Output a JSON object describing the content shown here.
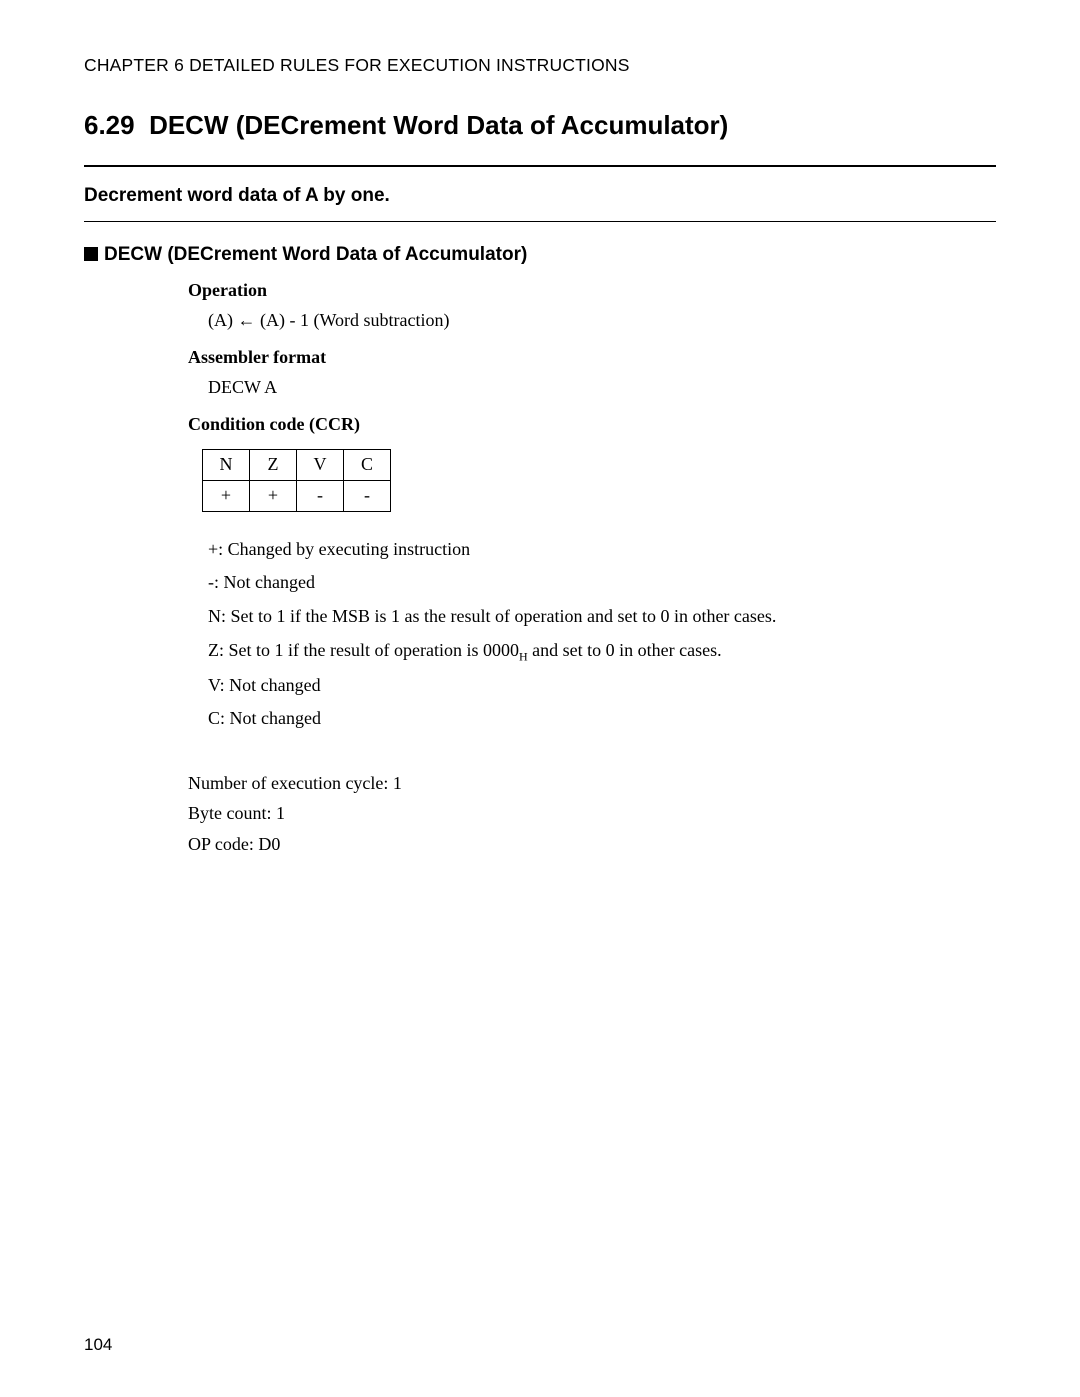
{
  "chapter_header": "CHAPTER 6  DETAILED RULES FOR EXECUTION INSTRUCTIONS",
  "section_number": "6.29",
  "section_title": "DECW (DECrement Word Data of Accumulator)",
  "summary": "Decrement word data of A by one.",
  "subsection_title": "DECW (DECrement Word Data of Accumulator)",
  "operation": {
    "label": "Operation",
    "text": "(A) ← (A) - 1 (Word subtraction)"
  },
  "assembler": {
    "label": "Assembler format",
    "text": "DECW A"
  },
  "ccr": {
    "label": "Condition code (CCR)",
    "headers": [
      "N",
      "Z",
      "V",
      "C"
    ],
    "values": [
      "+",
      "+",
      "-",
      "-"
    ],
    "legend": {
      "plus": "+: Changed by executing instruction",
      "minus": "-: Not changed",
      "N": "N: Set to 1 if the MSB is 1 as the result of operation and set to 0 in other cases.",
      "Z_pre": "Z: Set to 1 if the result of operation is 0000",
      "Z_sub": "H",
      "Z_post": " and set to 0 in other cases.",
      "V": "V: Not changed",
      "C": "C: Not changed"
    }
  },
  "meta": {
    "cycles": "Number of execution cycle: 1",
    "bytes": "Byte count: 1",
    "opcode": "OP code: D0"
  },
  "page_number": "104"
}
